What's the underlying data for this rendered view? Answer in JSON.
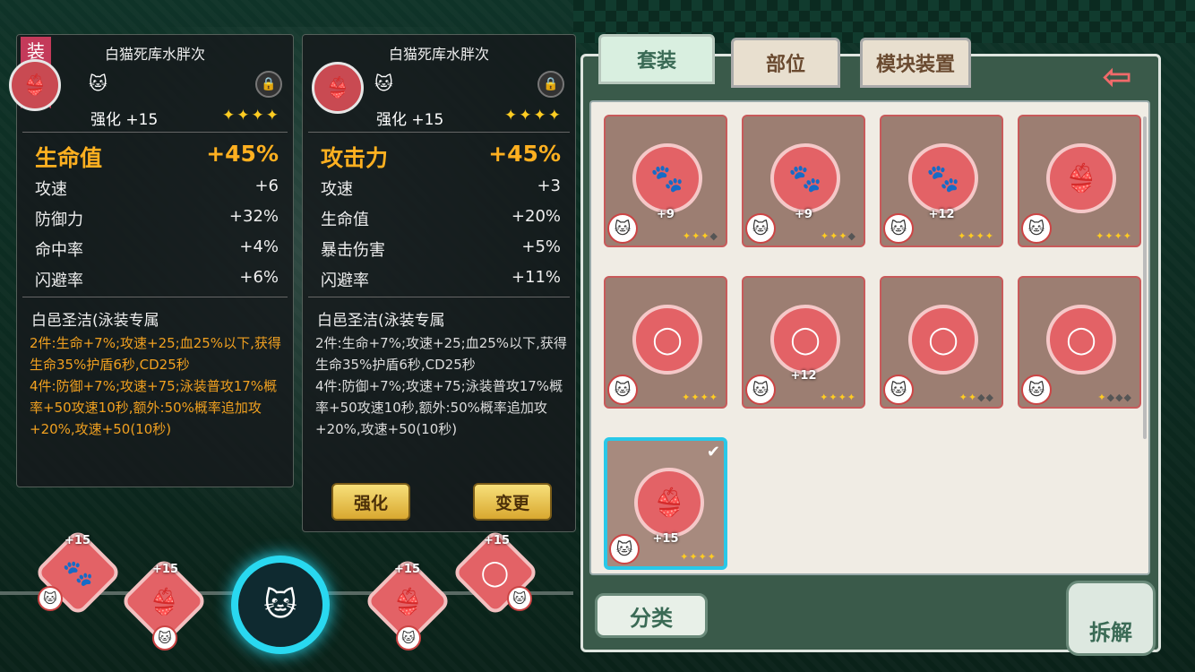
{
  "left_panel": {
    "equipped_label": "装备中",
    "name": "白猫死库水胖次",
    "enhance": "强化 +15",
    "stars": "✦✦✦✦",
    "main_stat": {
      "label": "生命值",
      "value": "+45%"
    },
    "stats": [
      {
        "label": "攻速",
        "value": "+6"
      },
      {
        "label": "防御力",
        "value": "+32%"
      },
      {
        "label": "命中率",
        "value": "+4%"
      },
      {
        "label": "闪避率",
        "value": "+6%"
      }
    ],
    "set_name": "白邑圣洁(泳装专属",
    "desc": "2件:生命+7%;攻速+25;血25%以下,获得生命35%护盾6秒,CD25秒\n4件:防御+7%;攻速+75;泳装普攻17%概率+50攻速10秒,额外:50%概率追加攻+20%,攻速+50(10秒)"
  },
  "right_detail": {
    "name": "白猫死库水胖次",
    "enhance": "强化 +15",
    "stars": "✦✦✦✦",
    "main_stat": {
      "label": "攻击力",
      "value": "+45%"
    },
    "stats": [
      {
        "label": "攻速",
        "value": "+3"
      },
      {
        "label": "生命值",
        "value": "+20%"
      },
      {
        "label": "暴击伤害",
        "value": "+5%"
      },
      {
        "label": "闪避率",
        "value": "+11%"
      }
    ],
    "set_name": "白邑圣洁(泳装专属",
    "desc": "2件:生命+7%;攻速+25;血25%以下,获得生命35%护盾6秒,CD25秒\n4件:防御+7%;攻速+75;泳装普攻17%概率+50攻速10秒,额外:50%概率追加攻+20%,攻速+50(10秒)",
    "enhance_btn": "强化",
    "change_btn": "变更"
  },
  "tabs": [
    {
      "label": "套装"
    },
    {
      "label": "部位"
    },
    {
      "label": "模块装置"
    }
  ],
  "items": [
    {
      "icon": "🐾",
      "level": "+9",
      "stars_on": 3,
      "selected": false
    },
    {
      "icon": "🐾",
      "level": "+9",
      "stars_on": 3,
      "selected": false
    },
    {
      "icon": "🐾",
      "level": "+12",
      "stars_on": 4,
      "selected": false
    },
    {
      "icon": "👙",
      "level": "",
      "stars_on": 4,
      "selected": false
    },
    {
      "icon": "◯",
      "level": "",
      "stars_on": 4,
      "selected": false
    },
    {
      "icon": "◯",
      "level": "+12",
      "stars_on": 4,
      "selected": false
    },
    {
      "icon": "◯",
      "level": "",
      "stars_on": 2,
      "selected": false
    },
    {
      "icon": "◯",
      "level": "",
      "stars_on": 1,
      "selected": false
    },
    {
      "icon": "👙",
      "level": "+15",
      "stars_on": 4,
      "selected": true
    }
  ],
  "bottom_slots": [
    {
      "icon": "🐾",
      "level": "+15"
    },
    {
      "icon": "👙",
      "level": "+15"
    },
    {
      "icon": "👙",
      "level": "+15"
    },
    {
      "icon": "◯",
      "level": "+15"
    }
  ],
  "cat_glyph": "🐱",
  "star_glyph": "✦",
  "lock_glyph": "🔒",
  "back_glyph": "⇦",
  "check_glyph": "✔",
  "fenlei_label": "分类",
  "chaijie_label": "拆解"
}
